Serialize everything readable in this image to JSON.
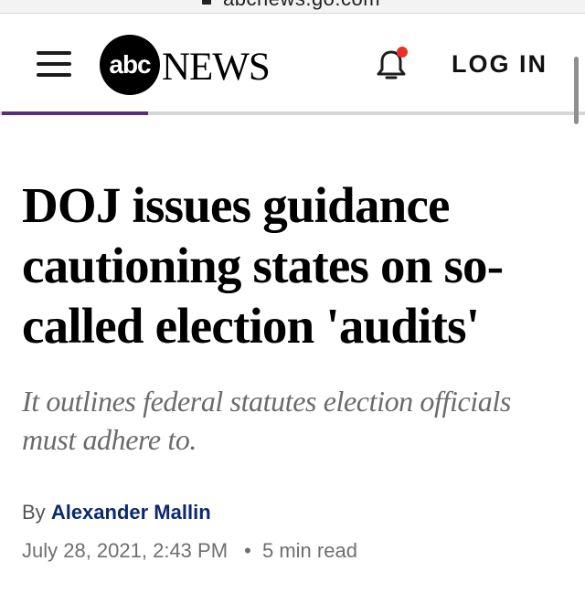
{
  "browser": {
    "url": "abcnews.go.com",
    "lock_icon": "lock-icon"
  },
  "header": {
    "menu_icon": "hamburger-menu-icon",
    "logo": {
      "circle_text": "abc",
      "wordmark": "NEWS"
    },
    "notification_icon": "bell-icon",
    "notification_dot_color": "#e8312b",
    "login_label": "LOG IN"
  },
  "reading_progress": {
    "fraction": 0.25,
    "color": "#55307a"
  },
  "article": {
    "headline": "DOJ issues guidance cautioning states on so-called election 'audits'",
    "subheadline": "It outlines federal statutes election officials must adhere to.",
    "byline_prefix": "By",
    "author": "Alexander Mallin",
    "date": "July 28, 2021, 2:43 PM",
    "separator": "•",
    "read_time": "5 min read"
  }
}
